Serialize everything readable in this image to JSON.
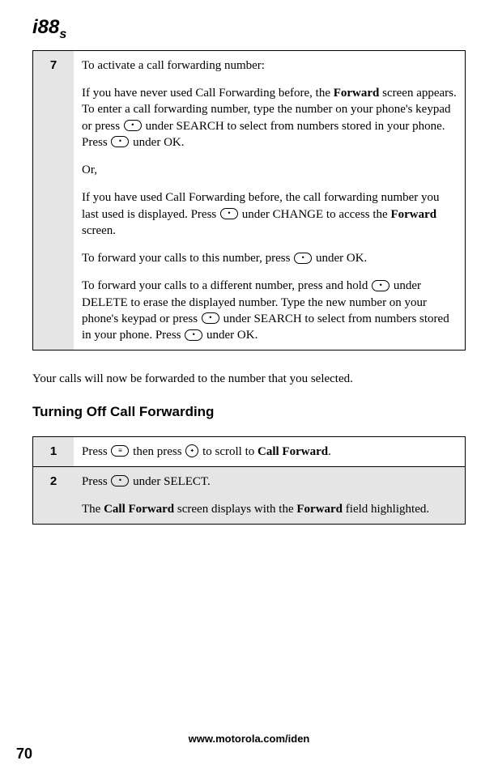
{
  "logo_main": "i88",
  "logo_sub": "s",
  "table1": {
    "step": "7",
    "p1_a": "To activate a call forwarding number:",
    "p2_a": "If you have never used Call Forwarding before, the ",
    "p2_b": "Forward",
    "p2_c": " screen appears. To enter a call forwarding number, type the number on your phone's keypad or press ",
    "p2_d": " under SEARCH to select from numbers stored in your phone. Press ",
    "p2_e": " under OK.",
    "p3": "Or,",
    "p4_a": "If you have used Call Forwarding before, the call forwarding number you last used is displayed. Press ",
    "p4_b": " under CHANGE to access the ",
    "p4_c": "Forward",
    "p4_d": " screen.",
    "p5_a": "To forward your calls to this number, press ",
    "p5_b": " under OK.",
    "p6_a": "To forward your calls to a different number, press and hold ",
    "p6_b": " under DELETE to erase the displayed number. Type the new number on your phone's keypad or press ",
    "p6_c": " under SEARCH to select from numbers stored in your phone. Press ",
    "p6_d": " under OK."
  },
  "mid_text": "Your calls will now be forwarded to the number that you selected.",
  "section_heading": "Turning Off Call Forwarding",
  "table2": {
    "r1": {
      "step": "1",
      "a": "Press ",
      "b": " then press ",
      "c": " to scroll to ",
      "d": "Call Forward",
      "e": "."
    },
    "r2": {
      "step": "2",
      "a": "Press ",
      "b": " under SELECT.",
      "c": "The ",
      "d": "Call Forward",
      "e": " screen displays with the ",
      "f": "Forward",
      "g": " field highlighted."
    }
  },
  "footer_url": "www.motorola.com/iden",
  "page_number": "70"
}
